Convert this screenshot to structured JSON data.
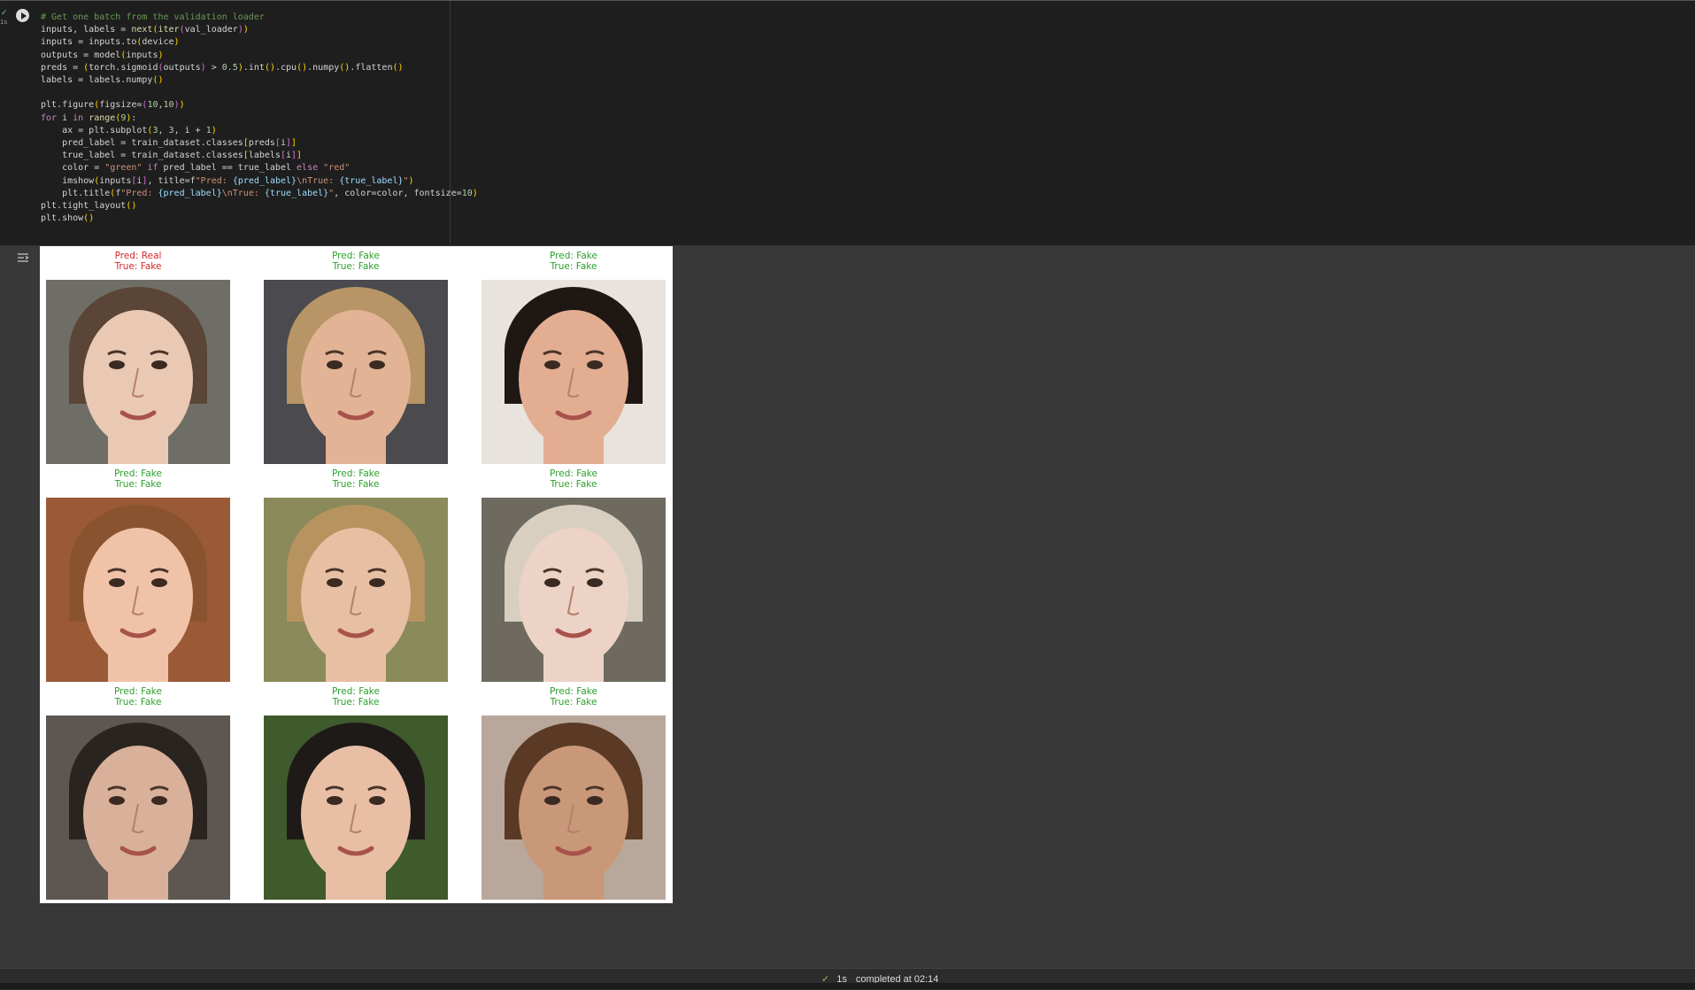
{
  "cell": {
    "exec_status": "✓",
    "exec_time": "1s",
    "code_lines": [
      "# Get one batch from the validation loader",
      "inputs, labels = next(iter(val_loader))",
      "inputs = inputs.to(device)",
      "outputs = model(inputs)",
      "preds = (torch.sigmoid(outputs) > 0.5).int().cpu().numpy().flatten()",
      "labels = labels.numpy()",
      "",
      "plt.figure(figsize=(10,10))",
      "for i in range(9):",
      "    ax = plt.subplot(3, 3, i + 1)",
      "    pred_label = train_dataset.classes[preds[i]]",
      "    true_label = train_dataset.classes[labels[i]]",
      "    color = \"green\" if pred_label == true_label else \"red\"",
      "    imshow(inputs[i], title=f\"Pred: {pred_label}\\nTrue: {true_label}\")",
      "    plt.title(f\"Pred: {pred_label}\\nTrue: {true_label}\", color=color, fontsize=10)",
      "plt.tight_layout()",
      "plt.show()"
    ]
  },
  "output": {
    "panels": [
      {
        "pred": "Pred: Real",
        "true": "True: Fake",
        "color": "#d62728",
        "skin": "#e9c9b3",
        "hair": "#5a4536",
        "bg": "#6f6e66"
      },
      {
        "pred": "Pred: Fake",
        "true": "True: Fake",
        "color": "#2ca02c",
        "skin": "#e2b495",
        "hair": "#b89566",
        "bg": "#4a4a4f"
      },
      {
        "pred": "Pred: Fake",
        "true": "True: Fake",
        "color": "#2ca02c",
        "skin": "#e3ad92",
        "hair": "#1e1714",
        "bg": "#e8e3dc"
      },
      {
        "pred": "Pred: Fake",
        "true": "True: Fake",
        "color": "#2ca02c",
        "skin": "#f0c3a8",
        "hair": "#8a5330",
        "bg": "#9a5a36"
      },
      {
        "pred": "Pred: Fake",
        "true": "True: Fake",
        "color": "#2ca02c",
        "skin": "#e7bfa2",
        "hair": "#b7935f",
        "bg": "#8a8a5a"
      },
      {
        "pred": "Pred: Fake",
        "true": "True: Fake",
        "color": "#2ca02c",
        "skin": "#ecd3c6",
        "hair": "#d8cfc0",
        "bg": "#6e6a60"
      },
      {
        "pred": "Pred: Fake",
        "true": "True: Fake",
        "color": "#2ca02c",
        "skin": "#d9b09a",
        "hair": "#2a2420",
        "bg": "#5e5650"
      },
      {
        "pred": "Pred: Fake",
        "true": "True: Fake",
        "color": "#2ca02c",
        "skin": "#e8bfa5",
        "hair": "#1e1a18",
        "bg": "#3f5a2c"
      },
      {
        "pred": "Pred: Fake",
        "true": "True: Fake",
        "color": "#2ca02c",
        "skin": "#c99878",
        "hair": "#5a3a24",
        "bg": "#b8a79a"
      }
    ]
  },
  "status": {
    "check": "✓",
    "duration": "1s",
    "completed": "completed at 02:14"
  }
}
